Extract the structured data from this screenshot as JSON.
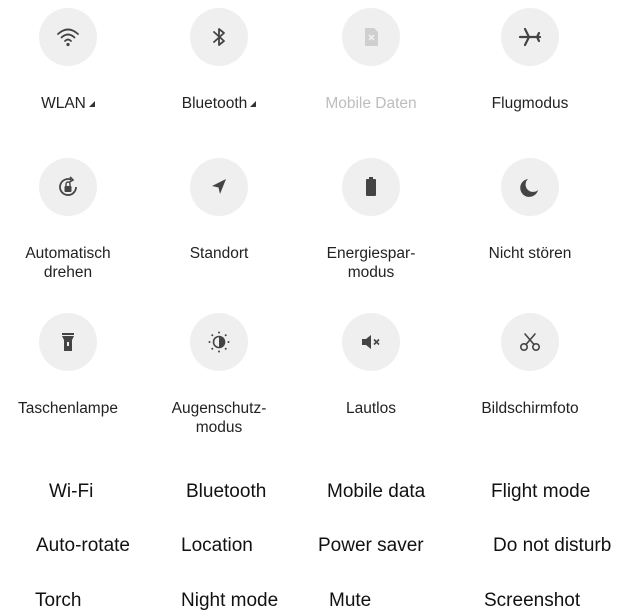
{
  "tiles": [
    {
      "label": "WLAN",
      "icon": "wifi-icon",
      "caret": true,
      "dim": false
    },
    {
      "label": "Bluetooth",
      "icon": "bluetooth-icon",
      "caret": true,
      "dim": false
    },
    {
      "label": "Mobile Daten",
      "icon": "sim-card-icon",
      "caret": false,
      "dim": true
    },
    {
      "label": "Flugmodus",
      "icon": "airplane-icon",
      "caret": false,
      "dim": false
    },
    {
      "label": "Automatisch\ndrehen",
      "icon": "auto-rotate-icon",
      "caret": false,
      "dim": false
    },
    {
      "label": "Standort",
      "icon": "location-arrow-icon",
      "caret": false,
      "dim": false
    },
    {
      "label": "Energiespar-\nmodus",
      "icon": "battery-icon",
      "caret": false,
      "dim": false
    },
    {
      "label": "Nicht stören",
      "icon": "moon-icon",
      "caret": false,
      "dim": false
    },
    {
      "label": "Taschenlampe",
      "icon": "flashlight-icon",
      "caret": false,
      "dim": false
    },
    {
      "label": "Augenschutz-\nmodus",
      "icon": "eye-comfort-sun-icon",
      "caret": false,
      "dim": false
    },
    {
      "label": "Lautlos",
      "icon": "mute-speaker-icon",
      "caret": false,
      "dim": false
    },
    {
      "label": "Bildschirmfoto",
      "icon": "scissors-icon",
      "caret": false,
      "dim": false
    }
  ],
  "translations": [
    "Wi-Fi",
    "Bluetooth",
    "Mobile data",
    "Flight mode",
    "Auto-rotate",
    "Location",
    "Power saver",
    "Do not disturb",
    "Torch",
    "Night mode",
    "Mute",
    "Screenshot"
  ]
}
